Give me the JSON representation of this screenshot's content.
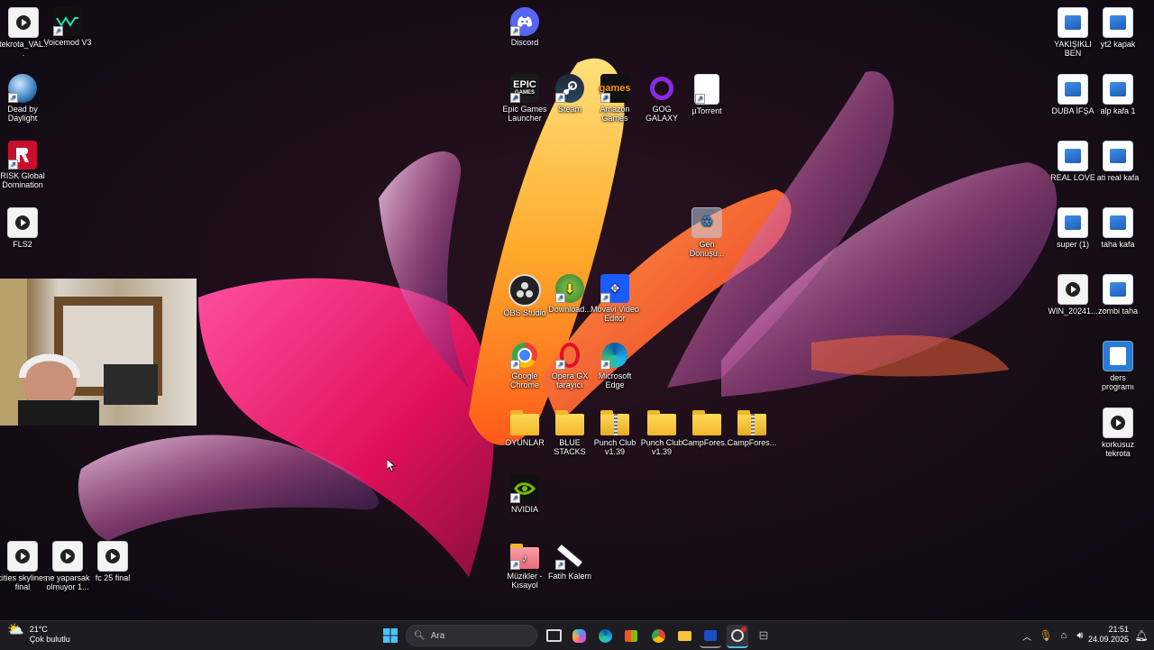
{
  "desktop": {
    "icons_left": [
      {
        "label": "tekrota_VAL...",
        "kind": "video"
      },
      {
        "label": "Voicemod V3",
        "kind": "app"
      },
      {
        "label": "Dead by Daylight",
        "kind": "app"
      },
      {
        "label": "RISK Global Domination",
        "kind": "app"
      },
      {
        "label": "FLS2",
        "kind": "video"
      },
      {
        "label": "cities skylines final",
        "kind": "video"
      },
      {
        "label": "ne yaparsak olmuyor 1...",
        "kind": "video"
      },
      {
        "label": "fc 25 final",
        "kind": "video"
      }
    ],
    "icons_center": [
      {
        "label": "Discord"
      },
      {
        "label": "Epic Games Launcher"
      },
      {
        "label": "Steam"
      },
      {
        "label": "Amazon Games"
      },
      {
        "label": "GOG GALAXY"
      },
      {
        "label": "µTorrent"
      },
      {
        "label": "Geri Dönüşü..."
      },
      {
        "label": "OBS Studio"
      },
      {
        "label": "Download..."
      },
      {
        "label": "Movavi Video Editor"
      },
      {
        "label": "Google Chrome"
      },
      {
        "label": "Opera GX tarayıcı"
      },
      {
        "label": "Microsoft Edge"
      },
      {
        "label": "OYUNLAR"
      },
      {
        "label": "BLUE STACKS"
      },
      {
        "label": "Punch Club v1.39"
      },
      {
        "label": "Punch Club v1.39"
      },
      {
        "label": "CampFores..."
      },
      {
        "label": "CampFores..."
      },
      {
        "label": "NVIDIA"
      },
      {
        "label": "Müzikler - Kısayol"
      },
      {
        "label": "Fatih Kalem"
      }
    ],
    "icons_right": [
      {
        "label": "YAKIŞIKLI BEN"
      },
      {
        "label": "yt2 kapak"
      },
      {
        "label": "DUBA İFŞA"
      },
      {
        "label": "alp kafa 1"
      },
      {
        "label": "REAL LOVE"
      },
      {
        "label": "ati real kafa"
      },
      {
        "label": "super (1)"
      },
      {
        "label": "taha kafa"
      },
      {
        "label": "WIN_20241..."
      },
      {
        "label": "zombi taha"
      },
      {
        "label": "ders programı"
      },
      {
        "label": "korkusuz tekrota"
      }
    ],
    "icon_text": {
      "epic": "EPIC",
      "epic_sub": "GAMES",
      "amazon": "games"
    }
  },
  "taskbar": {
    "weather_temp": "21°C",
    "weather_desc": "Çok bulutlu",
    "search_placeholder": "Ara",
    "time": "21:51",
    "date": "24.09.2025"
  },
  "colors": {
    "accent": "#0078d4",
    "taskbar_bg": "#1c1c22"
  }
}
